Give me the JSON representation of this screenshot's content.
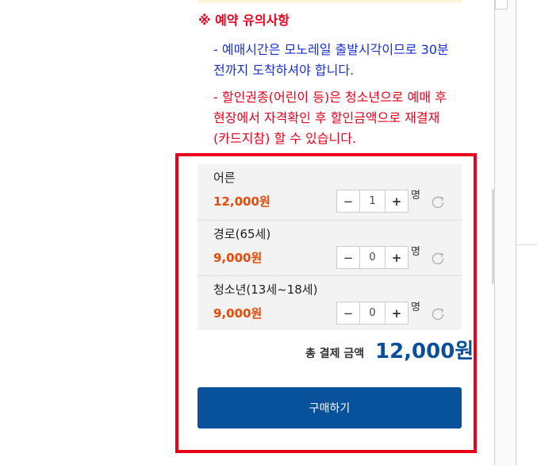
{
  "notice": {
    "title": "※ 예약 유의사항",
    "line_blue": "- 예매시간은 모노레일 출발시각이므로 30분 전까지 도착하셔야 합니다.",
    "line_red": "- 할인권종(어린이 등)은 청소년으로 예매 후 현장에서 자격확인 후 할인금액으로 재결재(카드지참) 할 수 있습니다."
  },
  "tickets": [
    {
      "label": "어른",
      "price": "12,000원",
      "quantity": "1",
      "unit": "명"
    },
    {
      "label": "경로(65세)",
      "price": "9,000원",
      "quantity": "0",
      "unit": "명"
    },
    {
      "label": "청소년(13세~18세)",
      "price": "9,000원",
      "quantity": "0",
      "unit": "명"
    }
  ],
  "stepper": {
    "minus": "−",
    "plus": "+"
  },
  "total": {
    "label": "총 결제 금액",
    "value": "12,000원"
  },
  "purchase_button": "구매하기",
  "colors": {
    "notice_red": "#e8001c",
    "notice_blue": "#1b2ed1",
    "price_orange": "#e84a05",
    "total_blue": "#0a4f9c",
    "button_blue": "#08519b",
    "highlight_border": "#e8001c"
  },
  "icons": {
    "reset": "refresh-icon"
  }
}
